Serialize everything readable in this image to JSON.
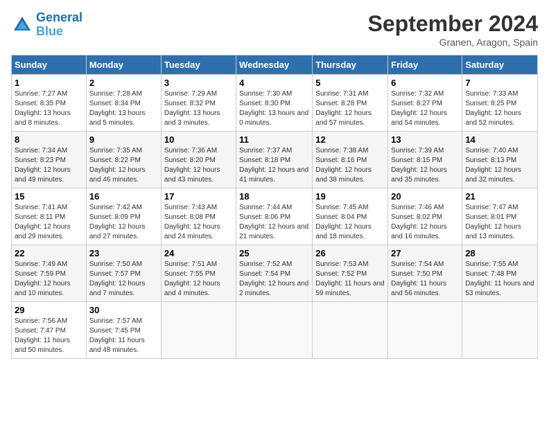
{
  "header": {
    "logo_line1": "General",
    "logo_line2": "Blue",
    "month": "September 2024",
    "location": "Granen, Aragon, Spain"
  },
  "weekdays": [
    "Sunday",
    "Monday",
    "Tuesday",
    "Wednesday",
    "Thursday",
    "Friday",
    "Saturday"
  ],
  "weeks": [
    [
      {
        "day": "1",
        "sunrise": "7:27 AM",
        "sunset": "8:35 PM",
        "daylight": "13 hours and 8 minutes."
      },
      {
        "day": "2",
        "sunrise": "7:28 AM",
        "sunset": "8:34 PM",
        "daylight": "13 hours and 5 minutes."
      },
      {
        "day": "3",
        "sunrise": "7:29 AM",
        "sunset": "8:32 PM",
        "daylight": "13 hours and 3 minutes."
      },
      {
        "day": "4",
        "sunrise": "7:30 AM",
        "sunset": "8:30 PM",
        "daylight": "13 hours and 0 minutes."
      },
      {
        "day": "5",
        "sunrise": "7:31 AM",
        "sunset": "8:28 PM",
        "daylight": "12 hours and 57 minutes."
      },
      {
        "day": "6",
        "sunrise": "7:32 AM",
        "sunset": "8:27 PM",
        "daylight": "12 hours and 54 minutes."
      },
      {
        "day": "7",
        "sunrise": "7:33 AM",
        "sunset": "8:25 PM",
        "daylight": "12 hours and 52 minutes."
      }
    ],
    [
      {
        "day": "8",
        "sunrise": "7:34 AM",
        "sunset": "8:23 PM",
        "daylight": "12 hours and 49 minutes."
      },
      {
        "day": "9",
        "sunrise": "7:35 AM",
        "sunset": "8:22 PM",
        "daylight": "12 hours and 46 minutes."
      },
      {
        "day": "10",
        "sunrise": "7:36 AM",
        "sunset": "8:20 PM",
        "daylight": "12 hours and 43 minutes."
      },
      {
        "day": "11",
        "sunrise": "7:37 AM",
        "sunset": "8:18 PM",
        "daylight": "12 hours and 41 minutes."
      },
      {
        "day": "12",
        "sunrise": "7:38 AM",
        "sunset": "8:16 PM",
        "daylight": "12 hours and 38 minutes."
      },
      {
        "day": "13",
        "sunrise": "7:39 AM",
        "sunset": "8:15 PM",
        "daylight": "12 hours and 35 minutes."
      },
      {
        "day": "14",
        "sunrise": "7:40 AM",
        "sunset": "8:13 PM",
        "daylight": "12 hours and 32 minutes."
      }
    ],
    [
      {
        "day": "15",
        "sunrise": "7:41 AM",
        "sunset": "8:11 PM",
        "daylight": "12 hours and 29 minutes."
      },
      {
        "day": "16",
        "sunrise": "7:42 AM",
        "sunset": "8:09 PM",
        "daylight": "12 hours and 27 minutes."
      },
      {
        "day": "17",
        "sunrise": "7:43 AM",
        "sunset": "8:08 PM",
        "daylight": "12 hours and 24 minutes."
      },
      {
        "day": "18",
        "sunrise": "7:44 AM",
        "sunset": "8:06 PM",
        "daylight": "12 hours and 21 minutes."
      },
      {
        "day": "19",
        "sunrise": "7:45 AM",
        "sunset": "8:04 PM",
        "daylight": "12 hours and 18 minutes."
      },
      {
        "day": "20",
        "sunrise": "7:46 AM",
        "sunset": "8:02 PM",
        "daylight": "12 hours and 16 minutes."
      },
      {
        "day": "21",
        "sunrise": "7:47 AM",
        "sunset": "8:01 PM",
        "daylight": "12 hours and 13 minutes."
      }
    ],
    [
      {
        "day": "22",
        "sunrise": "7:49 AM",
        "sunset": "7:59 PM",
        "daylight": "12 hours and 10 minutes."
      },
      {
        "day": "23",
        "sunrise": "7:50 AM",
        "sunset": "7:57 PM",
        "daylight": "12 hours and 7 minutes."
      },
      {
        "day": "24",
        "sunrise": "7:51 AM",
        "sunset": "7:55 PM",
        "daylight": "12 hours and 4 minutes."
      },
      {
        "day": "25",
        "sunrise": "7:52 AM",
        "sunset": "7:54 PM",
        "daylight": "12 hours and 2 minutes."
      },
      {
        "day": "26",
        "sunrise": "7:53 AM",
        "sunset": "7:52 PM",
        "daylight": "11 hours and 59 minutes."
      },
      {
        "day": "27",
        "sunrise": "7:54 AM",
        "sunset": "7:50 PM",
        "daylight": "11 hours and 56 minutes."
      },
      {
        "day": "28",
        "sunrise": "7:55 AM",
        "sunset": "7:48 PM",
        "daylight": "11 hours and 53 minutes."
      }
    ],
    [
      {
        "day": "29",
        "sunrise": "7:56 AM",
        "sunset": "7:47 PM",
        "daylight": "11 hours and 50 minutes."
      },
      {
        "day": "30",
        "sunrise": "7:57 AM",
        "sunset": "7:45 PM",
        "daylight": "11 hours and 48 minutes."
      },
      null,
      null,
      null,
      null,
      null
    ]
  ]
}
